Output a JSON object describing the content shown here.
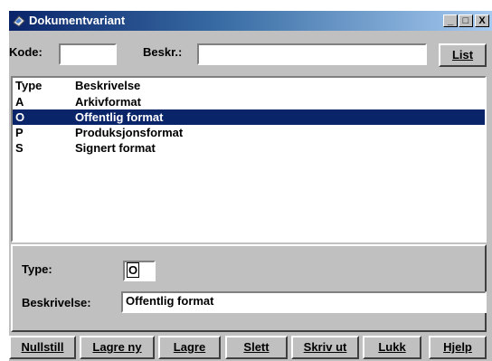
{
  "window": {
    "title": "Dokumentvariant",
    "minimize": "_",
    "maximize": "□",
    "close": "X"
  },
  "search": {
    "kode_label": "Kode:",
    "kode_value": "",
    "beskr_label": "Beskr.:",
    "beskr_value": "",
    "list_button": "List"
  },
  "list": {
    "header_type": "Type",
    "header_desc": "Beskrivelse",
    "rows": [
      {
        "type": "A",
        "desc": "Arkivformat"
      },
      {
        "type": "O",
        "desc": "Offentlig format",
        "selected": true
      },
      {
        "type": "P",
        "desc": "Produksjonsformat"
      },
      {
        "type": "S",
        "desc": "Signert format"
      }
    ]
  },
  "detail": {
    "type_label": "Type:",
    "type_value": "O",
    "desc_label": "Beskrivelse:",
    "desc_value": "Offentlig format"
  },
  "buttons": {
    "nullstill": "Nullstill",
    "lagre_ny": "Lagre ny",
    "lagre": "Lagre",
    "slett": "Slett",
    "skriv_ut": "Skriv ut",
    "lukk": "Lukk",
    "hjelp": "Hjelp"
  },
  "colors": {
    "selection": "#0a246a",
    "face": "#c0c0c0"
  }
}
